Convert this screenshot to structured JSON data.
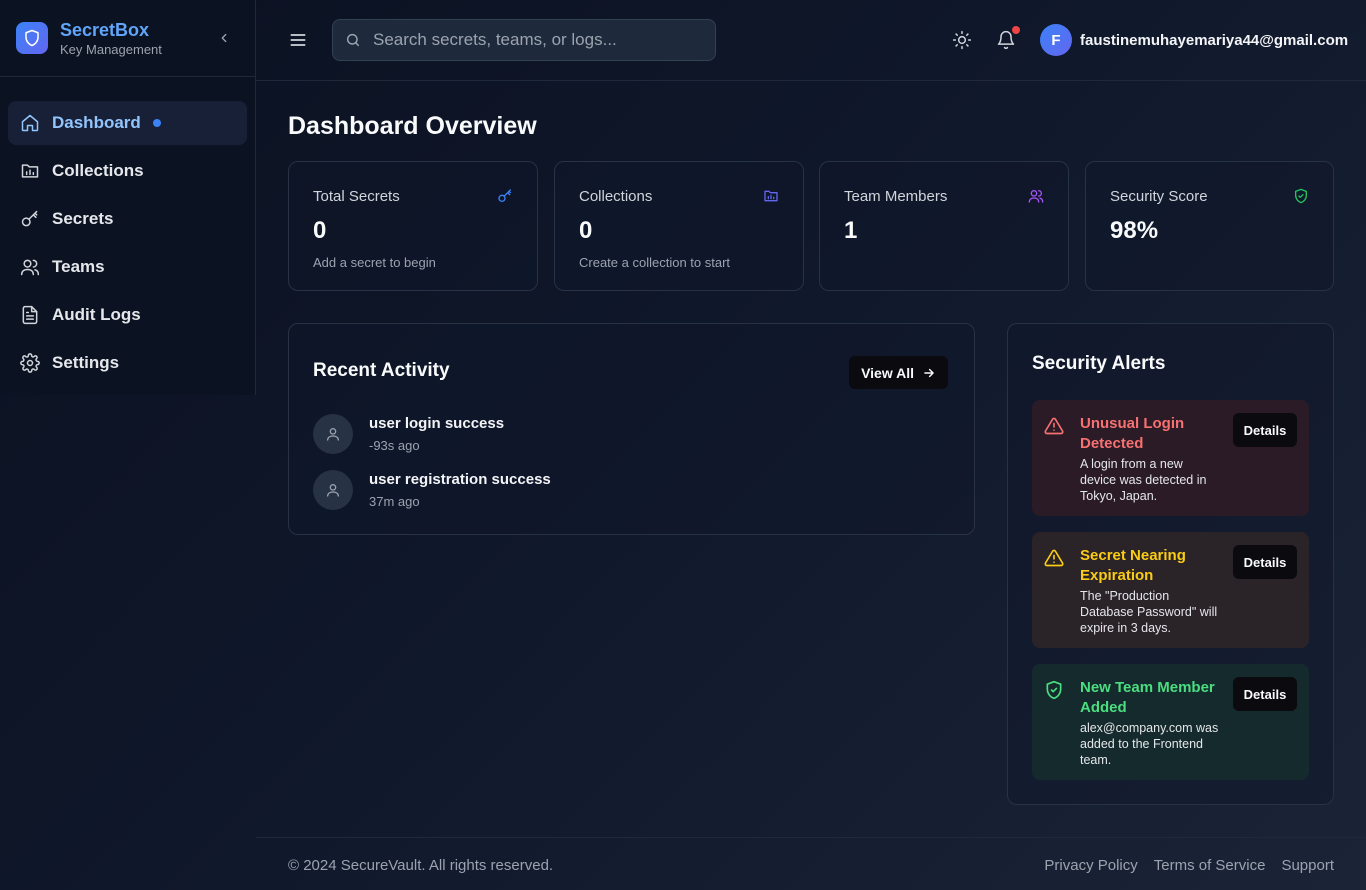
{
  "brand": {
    "name": "SecretBox",
    "subtitle": "Key Management"
  },
  "sidebar": {
    "items": [
      {
        "label": "Dashboard",
        "icon": "home-icon",
        "active": true
      },
      {
        "label": "Collections",
        "icon": "folder-chart-icon"
      },
      {
        "label": "Secrets",
        "icon": "key-icon"
      },
      {
        "label": "Teams",
        "icon": "users-icon"
      },
      {
        "label": "Audit Logs",
        "icon": "file-text-icon"
      },
      {
        "label": "Settings",
        "icon": "gear-icon"
      }
    ]
  },
  "header": {
    "search_placeholder": "Search secrets, teams, or logs...",
    "user_initial": "F",
    "user_email": "faustinemuhayemariya44@gmail.com"
  },
  "page": {
    "title": "Dashboard Overview"
  },
  "stats": [
    {
      "label": "Total Secrets",
      "value": "0",
      "sub": "Add a secret to begin",
      "icon": "key-icon",
      "color": "#3b82f6"
    },
    {
      "label": "Collections",
      "value": "0",
      "sub": "Create a collection to start",
      "icon": "folder-chart-icon",
      "color": "#6366f1"
    },
    {
      "label": "Team Members",
      "value": "1",
      "sub": "",
      "icon": "users-icon",
      "color": "#a855f7"
    },
    {
      "label": "Security Score",
      "value": "98%",
      "sub": "",
      "icon": "shield-check-icon",
      "color": "#22c55e"
    }
  ],
  "activity": {
    "title": "Recent Activity",
    "view_all": "View All",
    "items": [
      {
        "title": "user login success",
        "time": "-93s ago"
      },
      {
        "title": "user registration success",
        "time": "37m ago"
      }
    ]
  },
  "alerts": {
    "title": "Security Alerts",
    "details_label": "Details",
    "items": [
      {
        "title": "Unusual Login Detected",
        "desc": "A login from a new device was detected in Tokyo, Japan.",
        "severity": "red",
        "icon": "warning-icon"
      },
      {
        "title": "Secret Nearing Expiration",
        "desc": "The \"Production Database Password\" will expire in 3 days.",
        "severity": "yellow",
        "icon": "warning-icon"
      },
      {
        "title": "New Team Member Added",
        "desc": "alex@company.com was added to the Frontend team.",
        "severity": "green",
        "icon": "shield-check-icon"
      }
    ]
  },
  "footer": {
    "copyright": "© 2024 SecureVault. All rights reserved.",
    "links": [
      "Privacy Policy",
      "Terms of Service",
      "Support"
    ]
  }
}
